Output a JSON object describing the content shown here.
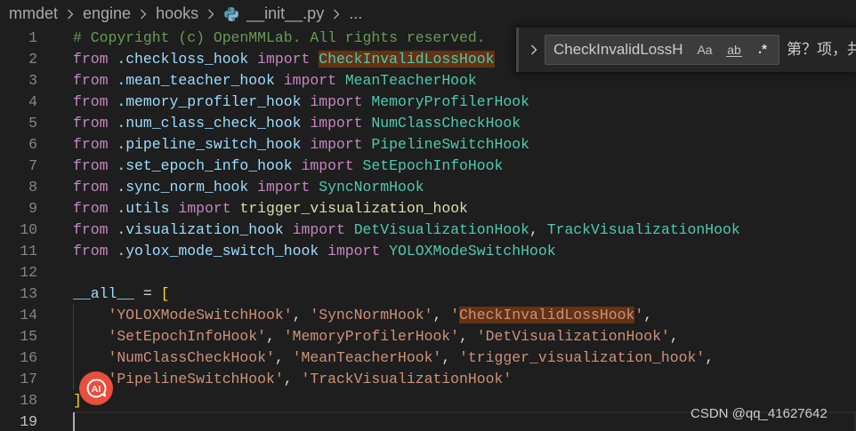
{
  "breadcrumb": {
    "items": [
      "mmdet",
      "engine",
      "hooks",
      "__init__.py",
      "..."
    ]
  },
  "find_widget": {
    "query": "CheckInvalidLossH",
    "match_case_label": "Aa",
    "whole_word_label": "ab",
    "regex_label": ".*",
    "result_text": "第？项，共"
  },
  "editor": {
    "active_line": 19,
    "lines": [
      {
        "number": 1,
        "tokens": [
          {
            "text": "# Copyright (c) OpenMMLab. All rights reserved.",
            "color": "#6a9955"
          }
        ]
      },
      {
        "number": 2,
        "tokens": [
          {
            "text": "from ",
            "color": "#c586c0"
          },
          {
            "text": ".checkloss_hook ",
            "color": "#9cdcfe"
          },
          {
            "text": "import ",
            "color": "#c586c0"
          },
          {
            "text": "CheckInvalidLossHook",
            "color": "#4ec9b0",
            "match": true
          }
        ]
      },
      {
        "number": 3,
        "tokens": [
          {
            "text": "from ",
            "color": "#c586c0"
          },
          {
            "text": ".mean_teacher_hook ",
            "color": "#9cdcfe"
          },
          {
            "text": "import ",
            "color": "#c586c0"
          },
          {
            "text": "MeanTeacherHook",
            "color": "#4ec9b0"
          }
        ]
      },
      {
        "number": 4,
        "tokens": [
          {
            "text": "from ",
            "color": "#c586c0"
          },
          {
            "text": ".memory_profiler_hook ",
            "color": "#9cdcfe"
          },
          {
            "text": "import ",
            "color": "#c586c0"
          },
          {
            "text": "MemoryProfilerHook",
            "color": "#4ec9b0"
          }
        ]
      },
      {
        "number": 5,
        "tokens": [
          {
            "text": "from ",
            "color": "#c586c0"
          },
          {
            "text": ".num_class_check_hook ",
            "color": "#9cdcfe"
          },
          {
            "text": "import ",
            "color": "#c586c0"
          },
          {
            "text": "NumClassCheckHook",
            "color": "#4ec9b0"
          }
        ]
      },
      {
        "number": 6,
        "tokens": [
          {
            "text": "from ",
            "color": "#c586c0"
          },
          {
            "text": ".pipeline_switch_hook ",
            "color": "#9cdcfe"
          },
          {
            "text": "import ",
            "color": "#c586c0"
          },
          {
            "text": "PipelineSwitchHook",
            "color": "#4ec9b0"
          }
        ]
      },
      {
        "number": 7,
        "tokens": [
          {
            "text": "from ",
            "color": "#c586c0"
          },
          {
            "text": ".set_epoch_info_hook ",
            "color": "#9cdcfe"
          },
          {
            "text": "import ",
            "color": "#c586c0"
          },
          {
            "text": "SetEpochInfoHook",
            "color": "#4ec9b0"
          }
        ]
      },
      {
        "number": 8,
        "tokens": [
          {
            "text": "from ",
            "color": "#c586c0"
          },
          {
            "text": ".sync_norm_hook ",
            "color": "#9cdcfe"
          },
          {
            "text": "import ",
            "color": "#c586c0"
          },
          {
            "text": "SyncNormHook",
            "color": "#4ec9b0"
          }
        ]
      },
      {
        "number": 9,
        "tokens": [
          {
            "text": "from ",
            "color": "#c586c0"
          },
          {
            "text": ".utils ",
            "color": "#9cdcfe"
          },
          {
            "text": "import ",
            "color": "#c586c0"
          },
          {
            "text": "trigger_visualization_hook",
            "color": "#dcdcaa"
          }
        ]
      },
      {
        "number": 10,
        "tokens": [
          {
            "text": "from ",
            "color": "#c586c0"
          },
          {
            "text": ".visualization_hook ",
            "color": "#9cdcfe"
          },
          {
            "text": "import ",
            "color": "#c586c0"
          },
          {
            "text": "DetVisualizationHook",
            "color": "#4ec9b0"
          },
          {
            "text": ", ",
            "color": "#d4d4d4"
          },
          {
            "text": "TrackVisualizationHook",
            "color": "#4ec9b0"
          }
        ]
      },
      {
        "number": 11,
        "tokens": [
          {
            "text": "from ",
            "color": "#c586c0"
          },
          {
            "text": ".yolox_mode_switch_hook ",
            "color": "#9cdcfe"
          },
          {
            "text": "import ",
            "color": "#c586c0"
          },
          {
            "text": "YOLOXModeSwitchHook",
            "color": "#4ec9b0"
          }
        ]
      },
      {
        "number": 12,
        "tokens": []
      },
      {
        "number": 13,
        "tokens": [
          {
            "text": "__all__",
            "color": "#9cdcfe"
          },
          {
            "text": " = ",
            "color": "#d4d4d4"
          },
          {
            "text": "[",
            "color": "#ffd700"
          }
        ]
      },
      {
        "number": 14,
        "tokens": [
          {
            "text": "    'YOLOXModeSwitchHook'",
            "color": "#ce9178"
          },
          {
            "text": ", ",
            "color": "#d4d4d4"
          },
          {
            "text": "'SyncNormHook'",
            "color": "#ce9178"
          },
          {
            "text": ", ",
            "color": "#d4d4d4"
          },
          {
            "text": "'",
            "color": "#ce9178"
          },
          {
            "text": "CheckInvalidLossHook",
            "color": "#ce9178",
            "match": true
          },
          {
            "text": "'",
            "color": "#ce9178"
          },
          {
            "text": ",",
            "color": "#d4d4d4"
          }
        ]
      },
      {
        "number": 15,
        "tokens": [
          {
            "text": "    'SetEpochInfoHook'",
            "color": "#ce9178"
          },
          {
            "text": ", ",
            "color": "#d4d4d4"
          },
          {
            "text": "'MemoryProfilerHook'",
            "color": "#ce9178"
          },
          {
            "text": ", ",
            "color": "#d4d4d4"
          },
          {
            "text": "'DetVisualizationHook'",
            "color": "#ce9178"
          },
          {
            "text": ",",
            "color": "#d4d4d4"
          }
        ]
      },
      {
        "number": 16,
        "tokens": [
          {
            "text": "    'NumClassCheckHook'",
            "color": "#ce9178"
          },
          {
            "text": ", ",
            "color": "#d4d4d4"
          },
          {
            "text": "'MeanTeacherHook'",
            "color": "#ce9178"
          },
          {
            "text": ", ",
            "color": "#d4d4d4"
          },
          {
            "text": "'trigger_visualization_hook'",
            "color": "#ce9178"
          },
          {
            "text": ",",
            "color": "#d4d4d4"
          }
        ]
      },
      {
        "number": 17,
        "tokens": [
          {
            "text": "    'PipelineSwitchHook'",
            "color": "#ce9178"
          },
          {
            "text": ", ",
            "color": "#d4d4d4"
          },
          {
            "text": "'TrackVisualizationHook'",
            "color": "#ce9178"
          }
        ]
      },
      {
        "number": 18,
        "tokens": [
          {
            "text": "]",
            "color": "#ffd700"
          }
        ]
      },
      {
        "number": 19,
        "tokens": []
      }
    ]
  },
  "ai_badge": {
    "label": "AI",
    "color": "#ea4e3c"
  },
  "watermark": "CSDN @qq_41627642",
  "theme": {
    "background": "#1e1e1e",
    "match_highlight": "#623314"
  }
}
